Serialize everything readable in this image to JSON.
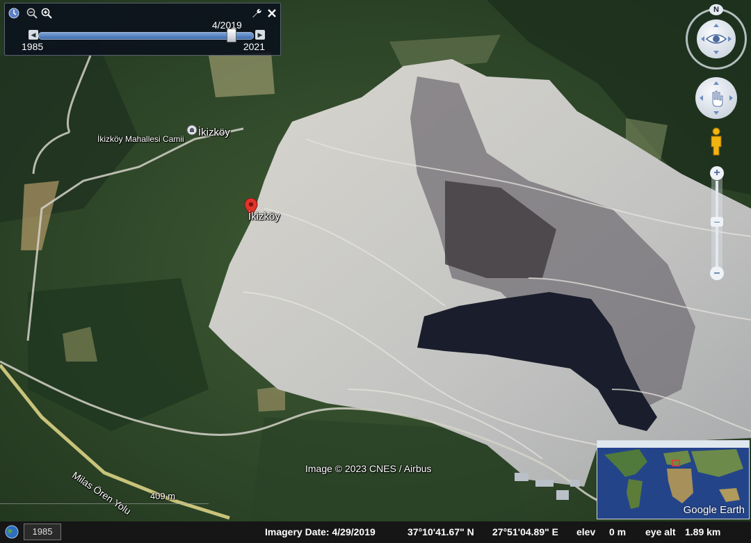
{
  "time_slider": {
    "current_date": "4/2019",
    "start_year": "1985",
    "end_year": "2021",
    "position_fraction": 0.9
  },
  "map_labels": {
    "mosque": "İkizköy Mahallesi Camii",
    "village_icon_label": "İkizköy",
    "placemark": "İkizköy",
    "road": "Milas Ören Yolu",
    "copyright": "Image © 2023 CNES / Airbus"
  },
  "scale": {
    "label": "409 m"
  },
  "status": {
    "year_badge": "1985",
    "imagery_date": "Imagery Date: 4/29/2019",
    "latitude": "37°10'41.67\" N",
    "longitude": "27°51'04.89\" E",
    "elev_label": "elev",
    "elev_value": "0 m",
    "eye_alt_label": "eye alt",
    "eye_alt_value": "1.89 km"
  },
  "compass": {
    "north": "N"
  },
  "minimap": {
    "brand": "Google Earth"
  },
  "colors": {
    "forest": "#2f4a2a",
    "mine": "#c9c9c4",
    "water": "#1c2030",
    "panel": "#0a101c",
    "slider": "#3c6bb0"
  },
  "icons": [
    "clock-icon",
    "zoom-out-icon",
    "zoom-in-icon",
    "wrench-icon",
    "close-icon",
    "compass-icon",
    "pan-icon",
    "pegman-icon",
    "zoom-plus-icon",
    "zoom-minus-icon",
    "placemark-icon"
  ]
}
